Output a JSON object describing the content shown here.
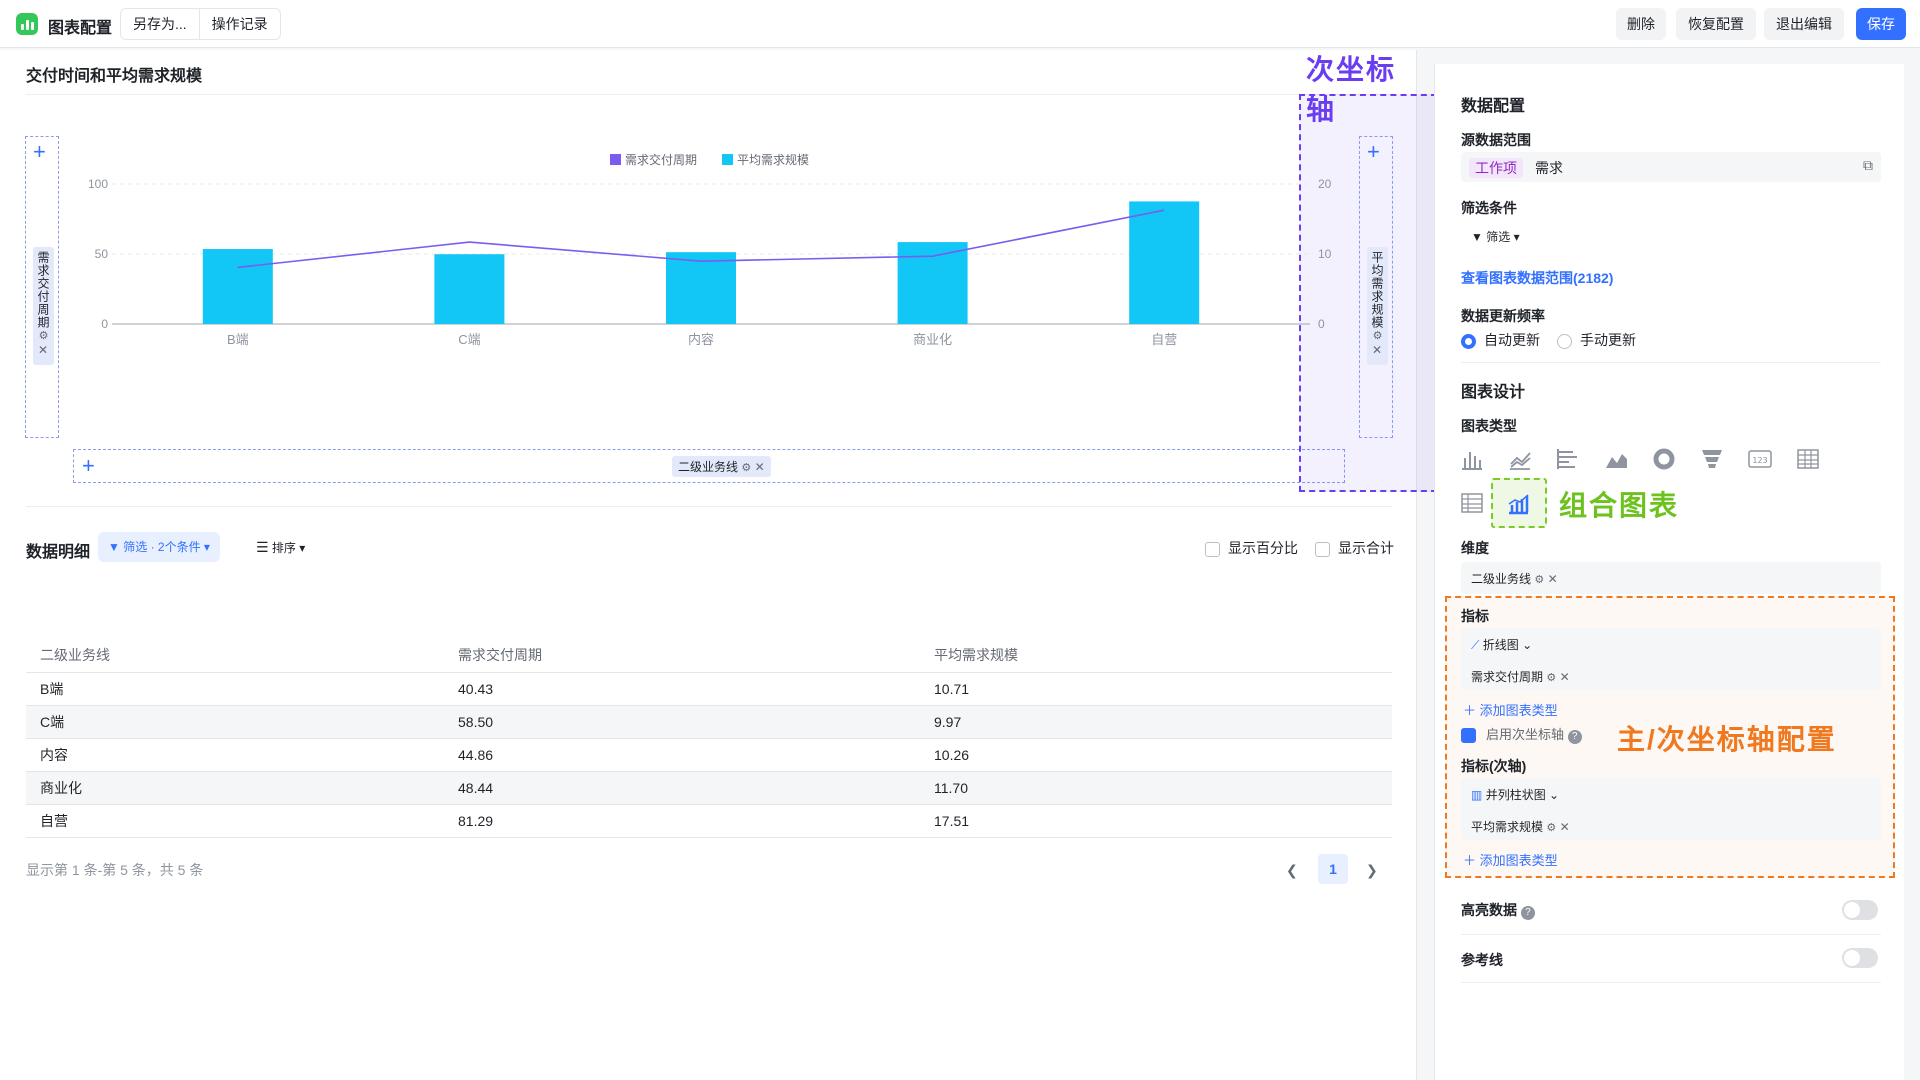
{
  "topbar": {
    "title": "图表配置",
    "save_as": "另存为...",
    "history": "操作记录",
    "delete": "删除",
    "restore": "恢复配置",
    "exit_edit": "退出编辑",
    "save": "保存"
  },
  "chart_panel": {
    "title": "交付时间和平均需求规模",
    "left_axis_field": "需求交付周期",
    "right_axis_field": "平均需求规模",
    "dimension_field": "二级业务线"
  },
  "chart_data": {
    "type": "bar",
    "categories": [
      "B端",
      "C端",
      "内容",
      "商业化",
      "自营"
    ],
    "series": [
      {
        "name": "需求交付周期",
        "type": "line",
        "axis": "left",
        "color": "#7b5cf0",
        "values": [
          40.43,
          58.5,
          44.86,
          48.44,
          81.29
        ]
      },
      {
        "name": "平均需求规模",
        "type": "bar",
        "axis": "right",
        "color": "#12c6f5",
        "values": [
          10.71,
          9.97,
          10.26,
          11.7,
          17.51
        ]
      }
    ],
    "y_left": {
      "ticks": [
        "0",
        "50",
        "100"
      ],
      "range": [
        0,
        100
      ]
    },
    "y_right": {
      "ticks": [
        "0",
        "10",
        "20"
      ],
      "range": [
        0,
        20
      ]
    },
    "legend": "top-center"
  },
  "annotations": {
    "secondary_axis": "次坐标轴",
    "combo_chart": "组合图表",
    "axis_config": "主/次坐标轴配置"
  },
  "table": {
    "title": "数据明细",
    "filter": "筛选 · 2个条件",
    "sort": "排序",
    "show_percent": "显示百分比",
    "show_total": "显示合计",
    "columns": [
      "二级业务线",
      "需求交付周期",
      "平均需求规模"
    ],
    "rows": [
      [
        "B端",
        "40.43",
        "10.71"
      ],
      [
        "C端",
        "58.50",
        "9.97"
      ],
      [
        "内容",
        "44.86",
        "10.26"
      ],
      [
        "商业化",
        "48.44",
        "11.70"
      ],
      [
        "自营",
        "81.29",
        "17.51"
      ]
    ],
    "page_info": "显示第 1 条-第 5 条，共 5 条",
    "current_page": "1"
  },
  "side": {
    "data_config": "数据配置",
    "source_label": "源数据范围",
    "source_tag": "工作项",
    "source_value": "需求",
    "filter_label": "筛选条件",
    "filter_btn": "筛选",
    "view_range_link": "查看图表数据范围(2182)",
    "refresh_label": "数据更新频率",
    "auto_refresh": "自动更新",
    "manual_refresh": "手动更新",
    "chart_design": "图表设计",
    "chart_type_label": "图表类型",
    "dimension_label": "维度",
    "dimension_value": "二级业务线",
    "metric_label": "指标",
    "metric_chart_type": "折线图",
    "metric_value": "需求交付周期",
    "add_chart_type": "添加图表类型",
    "enable_secondary": "启用次坐标轴",
    "metric_secondary_label": "指标(次轴)",
    "secondary_chart_type": "并列柱状图",
    "secondary_metric_value": "平均需求规模",
    "add_chart_type_2": "添加图表类型",
    "highlight": "高亮数据",
    "reference_line": "参考线"
  }
}
